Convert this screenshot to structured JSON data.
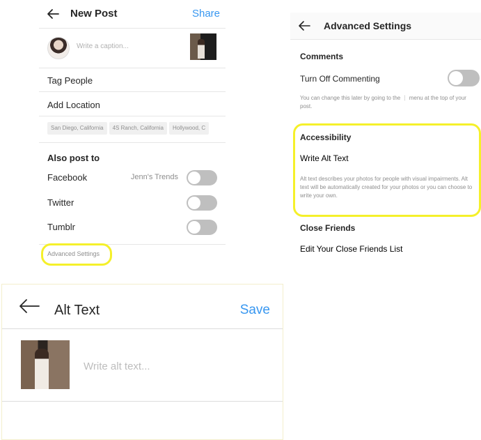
{
  "new_post": {
    "title": "New Post",
    "share_label": "Share",
    "caption_placeholder": "Write a caption...",
    "tag_people": "Tag People",
    "add_location": "Add Location",
    "location_suggestions": [
      "San Diego, California",
      "4S Ranch, California",
      "Hollywood, C"
    ],
    "also_post_to": "Also post to",
    "facebook": {
      "label": "Facebook",
      "account": "Jenn's Trends",
      "enabled": false
    },
    "twitter": {
      "label": "Twitter",
      "enabled": false
    },
    "tumblr": {
      "label": "Tumblr",
      "enabled": false
    },
    "advanced_settings": "Advanced Settings"
  },
  "advanced": {
    "title": "Advanced Settings",
    "comments_heading": "Comments",
    "turn_off_commenting": "Turn Off Commenting",
    "commenting_off": false,
    "comments_help": "You can change this later by going to the ⋮ menu at the top of your post.",
    "accessibility_heading": "Accessibility",
    "write_alt_text": "Write Alt Text",
    "alt_help": "Alt text describes your photos for people with visual impairments. Alt text will be automatically created for your photos or you can choose to write your own.",
    "close_friends_heading": "Close Friends",
    "edit_close_friends": "Edit Your Close Friends List"
  },
  "alt_text": {
    "title": "Alt Text",
    "save_label": "Save",
    "placeholder": "Write alt text..."
  },
  "colors": {
    "accent_link": "#3897f0",
    "highlight": "#f5f02a",
    "toggle_off": "#bfbfbf"
  },
  "icons": {
    "back": "arrow-left-icon"
  }
}
